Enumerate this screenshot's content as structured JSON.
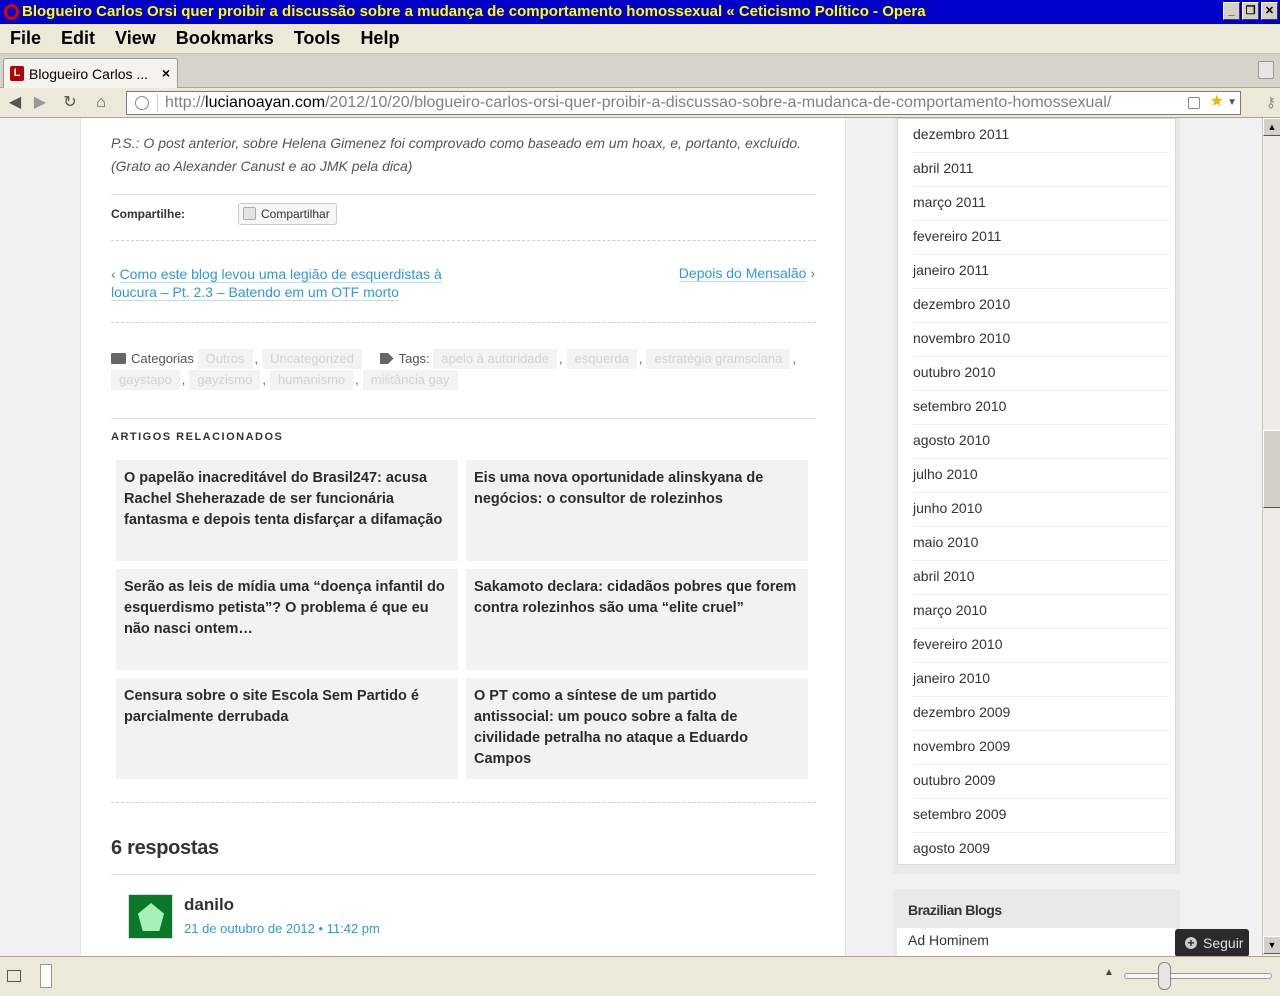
{
  "window": {
    "title": "Blogueiro Carlos Orsi quer proibir a discussão sobre a mudança de comportamento homossexual « Ceticismo Político - Opera",
    "buttons": [
      "_",
      "❐",
      "✕"
    ]
  },
  "menu": [
    "File",
    "Edit",
    "View",
    "Bookmarks",
    "Tools",
    "Help"
  ],
  "tab": {
    "title": "Blogueiro Carlos ...",
    "close": "×",
    "favicon": "L"
  },
  "address": {
    "prefix": "http://",
    "host": "lucianoayan.com",
    "path": "/2012/10/20/blogueiro-carlos-orsi-quer-proibir-a-discussao-sobre-a-mudanca-de-comportamento-homossexual/"
  },
  "post": {
    "ps": "P.S.: O post anterior, sobre Helena Gimenez foi comprovado como baseado em um hoax, e, portanto, excluído. (Grato ao Alexander Canust e ao JMK pela dica)",
    "share_label": "Compartilhe:",
    "share_button": "Compartilhar",
    "prev_arrow": "‹",
    "prev_line1": "Como este blog levou uma legião de esquerdistas à",
    "prev_line2": "loucura – Pt. 2.3 – Batendo em um OTF morto",
    "next_label": "Depois do Mensalão",
    "next_arrow": "›",
    "categories_label": "Categorias",
    "categories": [
      "Outros",
      "Uncategorized"
    ],
    "tags_label": "Tags:",
    "tags": [
      "apelo à autoridade",
      "esquerda",
      "estratégia gramsciana",
      "gaystapo",
      "gayzismo",
      "humanismo",
      "militância gay"
    ],
    "comma": ","
  },
  "related": {
    "title": "ARTIGOS RELACIONADOS",
    "items": [
      "O papelão inacreditável do Brasil247: acusa Rachel Sheherazade de ser funcionária fantasma e depois tenta disfarçar a difamação",
      "Eis uma nova oportunidade alinskyana de negócios: o consultor de rolezinhos",
      "Serão as leis de mídia uma “doença infantil do esquerdismo petista”? O problema é que eu não nasci ontem…",
      "Sakamoto declara: cidadãos pobres que forem contra rolezinhos são uma “elite cruel”",
      "Censura sobre o site Escola Sem Partido é parcialmente derrubada",
      "O PT como a síntese de um partido antissocial: um pouco sobre a falta de civilidade petralha no ataque a Eduardo Campos"
    ]
  },
  "comments": {
    "title": "6 respostas",
    "first_author": "danilo",
    "first_date": "21 de outubro de 2012 • 11:42 pm"
  },
  "sidebar": {
    "archives": [
      "dezembro 2011",
      "abril 2011",
      "março 2011",
      "fevereiro 2011",
      "janeiro 2011",
      "dezembro 2010",
      "novembro 2010",
      "outubro 2010",
      "setembro 2010",
      "agosto 2010",
      "julho 2010",
      "junho 2010",
      "maio 2010",
      "abril 2010",
      "março 2010",
      "fevereiro 2010",
      "janeiro 2010",
      "dezembro 2009",
      "novembro 2009",
      "outubro 2009",
      "setembro 2009",
      "agosto 2009"
    ],
    "blogroll_title": "Brazilian Blogs",
    "blogroll_first": "Ad Hominem"
  },
  "follow_button": "Seguir",
  "colors": {
    "link": "#2e99d6",
    "titlebar": "#0000c8",
    "titletext": "#ffff00"
  }
}
